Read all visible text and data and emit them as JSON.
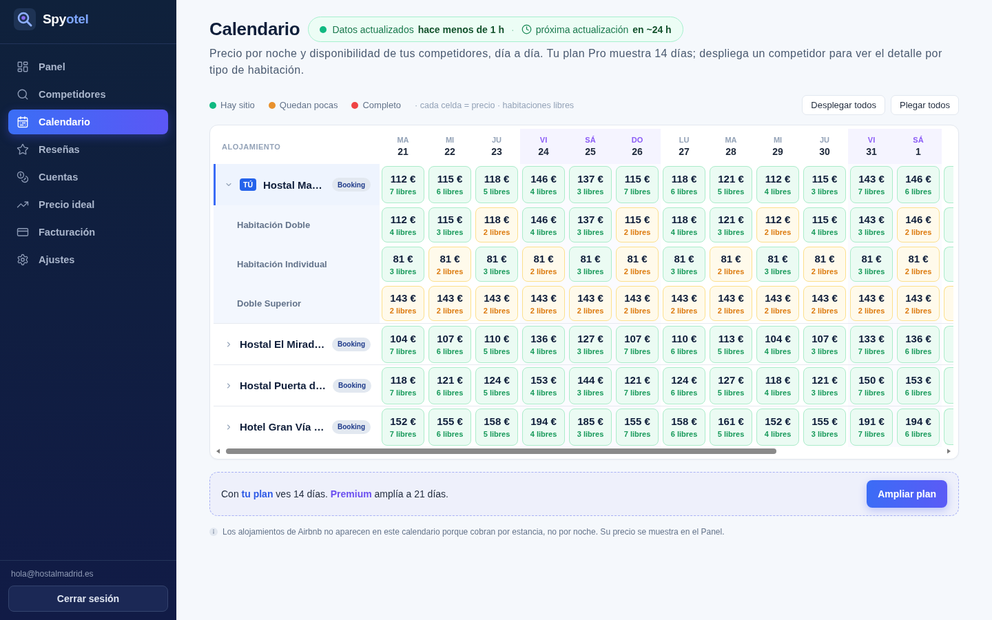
{
  "sidebar": {
    "brand": {
      "lead": "Spy",
      "rest": "otel"
    },
    "nav": [
      {
        "label": "Panel",
        "selected": false
      },
      {
        "label": "Competidores",
        "selected": false
      },
      {
        "label": "Calendario",
        "selected": true
      },
      {
        "label": "Reseñas",
        "selected": false
      },
      {
        "label": "Cuentas",
        "selected": false
      },
      {
        "label": "Precio ideal",
        "selected": false
      },
      {
        "label": "Facturación",
        "selected": false
      },
      {
        "label": "Ajustes",
        "selected": false
      }
    ],
    "email": "hola@hostalmadrid.es",
    "logout": "Cerrar sesión"
  },
  "header": {
    "title": "Calendario",
    "status": {
      "updated_label": "Datos actualizados",
      "updated_value": "hace menos de 1 h",
      "separator": "·",
      "next_label": "próxima actualización",
      "next_value": "en ~24 h"
    },
    "description": "Precio por noche y disponibilidad de tus competidores, día a día. Tu plan Pro muestra 14 días; despliega un competidor para ver el detalle por tipo de habitación."
  },
  "legend": {
    "items": [
      {
        "label": "Hay sitio",
        "color": "#10b981"
      },
      {
        "label": "Quedan pocas",
        "color": "#e8912d"
      },
      {
        "label": "Completo",
        "color": "#ef4444"
      }
    ],
    "note": "· cada celda = precio · habitaciones libres"
  },
  "actions": [
    "Desplegar todos",
    "Plegar todos"
  ],
  "calendar": {
    "column_label": "ALOJAMIENTO",
    "days": [
      {
        "weekday": "MA",
        "date": "21",
        "weekend": false
      },
      {
        "weekday": "MI",
        "date": "22",
        "weekend": false
      },
      {
        "weekday": "JU",
        "date": "23",
        "weekend": false
      },
      {
        "weekday": "VI",
        "date": "24",
        "weekend": true
      },
      {
        "weekday": "SÁ",
        "date": "25",
        "weekend": true
      },
      {
        "weekday": "DO",
        "date": "26",
        "weekend": true
      },
      {
        "weekday": "LU",
        "date": "27",
        "weekend": false
      },
      {
        "weekday": "MA",
        "date": "28",
        "weekend": false
      },
      {
        "weekday": "MI",
        "date": "29",
        "weekend": false
      },
      {
        "weekday": "JU",
        "date": "30",
        "weekend": false
      },
      {
        "weekday": "VI",
        "date": "31",
        "weekend": true
      },
      {
        "weekday": "SÁ",
        "date": "1",
        "weekend": true
      }
    ],
    "properties": [
      {
        "name": "Hostal Ma…",
        "own": true,
        "badge": "TÚ",
        "source": "Booking",
        "expanded": true,
        "cells": [
          {
            "price": "112 €",
            "rooms": "7 libres",
            "kind": "ok"
          },
          {
            "price": "115 €",
            "rooms": "6 libres",
            "kind": "ok"
          },
          {
            "price": "118 €",
            "rooms": "5 libres",
            "kind": "ok"
          },
          {
            "price": "146 €",
            "rooms": "4 libres",
            "kind": "ok"
          },
          {
            "price": "137 €",
            "rooms": "3 libres",
            "kind": "ok"
          },
          {
            "price": "115 €",
            "rooms": "7 libres",
            "kind": "ok"
          },
          {
            "price": "118 €",
            "rooms": "6 libres",
            "kind": "ok"
          },
          {
            "price": "121 €",
            "rooms": "5 libres",
            "kind": "ok"
          },
          {
            "price": "112 €",
            "rooms": "4 libres",
            "kind": "ok"
          },
          {
            "price": "115 €",
            "rooms": "3 libres",
            "kind": "ok"
          },
          {
            "price": "143 €",
            "rooms": "7 libres",
            "kind": "ok"
          },
          {
            "price": "146 €",
            "rooms": "6 libres",
            "kind": "ok"
          },
          {
            "kind": "ok"
          }
        ],
        "rooms": [
          {
            "name": "Habitación Doble",
            "cells": [
              {
                "price": "112 €",
                "rooms": "4 libres",
                "kind": "ok"
              },
              {
                "price": "115 €",
                "rooms": "3 libres",
                "kind": "ok"
              },
              {
                "price": "118 €",
                "rooms": "2 libres",
                "kind": "few"
              },
              {
                "price": "146 €",
                "rooms": "4 libres",
                "kind": "ok"
              },
              {
                "price": "137 €",
                "rooms": "3 libres",
                "kind": "ok"
              },
              {
                "price": "115 €",
                "rooms": "2 libres",
                "kind": "few"
              },
              {
                "price": "118 €",
                "rooms": "4 libres",
                "kind": "ok"
              },
              {
                "price": "121 €",
                "rooms": "3 libres",
                "kind": "ok"
              },
              {
                "price": "112 €",
                "rooms": "2 libres",
                "kind": "few"
              },
              {
                "price": "115 €",
                "rooms": "4 libres",
                "kind": "ok"
              },
              {
                "price": "143 €",
                "rooms": "3 libres",
                "kind": "ok"
              },
              {
                "price": "146 €",
                "rooms": "2 libres",
                "kind": "few"
              },
              {
                "kind": "ok"
              }
            ]
          },
          {
            "name": "Habitación Individual",
            "cells": [
              {
                "price": "81 €",
                "rooms": "3 libres",
                "kind": "ok"
              },
              {
                "price": "81 €",
                "rooms": "2 libres",
                "kind": "few"
              },
              {
                "price": "81 €",
                "rooms": "3 libres",
                "kind": "ok"
              },
              {
                "price": "81 €",
                "rooms": "2 libres",
                "kind": "few"
              },
              {
                "price": "81 €",
                "rooms": "3 libres",
                "kind": "ok"
              },
              {
                "price": "81 €",
                "rooms": "2 libres",
                "kind": "few"
              },
              {
                "price": "81 €",
                "rooms": "3 libres",
                "kind": "ok"
              },
              {
                "price": "81 €",
                "rooms": "2 libres",
                "kind": "few"
              },
              {
                "price": "81 €",
                "rooms": "3 libres",
                "kind": "ok"
              },
              {
                "price": "81 €",
                "rooms": "2 libres",
                "kind": "few"
              },
              {
                "price": "81 €",
                "rooms": "3 libres",
                "kind": "ok"
              },
              {
                "price": "81 €",
                "rooms": "2 libres",
                "kind": "few"
              },
              {
                "kind": "ok"
              }
            ]
          },
          {
            "name": "Doble Superior",
            "cells": [
              {
                "price": "143 €",
                "rooms": "2 libres",
                "kind": "few"
              },
              {
                "price": "143 €",
                "rooms": "2 libres",
                "kind": "few"
              },
              {
                "price": "143 €",
                "rooms": "2 libres",
                "kind": "few"
              },
              {
                "price": "143 €",
                "rooms": "2 libres",
                "kind": "few"
              },
              {
                "price": "143 €",
                "rooms": "2 libres",
                "kind": "few"
              },
              {
                "price": "143 €",
                "rooms": "2 libres",
                "kind": "few"
              },
              {
                "price": "143 €",
                "rooms": "2 libres",
                "kind": "few"
              },
              {
                "price": "143 €",
                "rooms": "2 libres",
                "kind": "few"
              },
              {
                "price": "143 €",
                "rooms": "2 libres",
                "kind": "few"
              },
              {
                "price": "143 €",
                "rooms": "2 libres",
                "kind": "few"
              },
              {
                "price": "143 €",
                "rooms": "2 libres",
                "kind": "few"
              },
              {
                "price": "143 €",
                "rooms": "2 libres",
                "kind": "few"
              },
              {
                "kind": "few"
              }
            ]
          }
        ]
      },
      {
        "name": "Hostal El Mirad…",
        "own": false,
        "source": "Booking",
        "expanded": false,
        "cells": [
          {
            "price": "104 €",
            "rooms": "7 libres",
            "kind": "ok"
          },
          {
            "price": "107 €",
            "rooms": "6 libres",
            "kind": "ok"
          },
          {
            "price": "110 €",
            "rooms": "5 libres",
            "kind": "ok"
          },
          {
            "price": "136 €",
            "rooms": "4 libres",
            "kind": "ok"
          },
          {
            "price": "127 €",
            "rooms": "3 libres",
            "kind": "ok"
          },
          {
            "price": "107 €",
            "rooms": "7 libres",
            "kind": "ok"
          },
          {
            "price": "110 €",
            "rooms": "6 libres",
            "kind": "ok"
          },
          {
            "price": "113 €",
            "rooms": "5 libres",
            "kind": "ok"
          },
          {
            "price": "104 €",
            "rooms": "4 libres",
            "kind": "ok"
          },
          {
            "price": "107 €",
            "rooms": "3 libres",
            "kind": "ok"
          },
          {
            "price": "133 €",
            "rooms": "7 libres",
            "kind": "ok"
          },
          {
            "price": "136 €",
            "rooms": "6 libres",
            "kind": "ok"
          },
          {
            "kind": "ok"
          }
        ]
      },
      {
        "name": "Hostal Puerta d…",
        "own": false,
        "source": "Booking",
        "expanded": false,
        "cells": [
          {
            "price": "118 €",
            "rooms": "7 libres",
            "kind": "ok"
          },
          {
            "price": "121 €",
            "rooms": "6 libres",
            "kind": "ok"
          },
          {
            "price": "124 €",
            "rooms": "5 libres",
            "kind": "ok"
          },
          {
            "price": "153 €",
            "rooms": "4 libres",
            "kind": "ok"
          },
          {
            "price": "144 €",
            "rooms": "3 libres",
            "kind": "ok"
          },
          {
            "price": "121 €",
            "rooms": "7 libres",
            "kind": "ok"
          },
          {
            "price": "124 €",
            "rooms": "6 libres",
            "kind": "ok"
          },
          {
            "price": "127 €",
            "rooms": "5 libres",
            "kind": "ok"
          },
          {
            "price": "118 €",
            "rooms": "4 libres",
            "kind": "ok"
          },
          {
            "price": "121 €",
            "rooms": "3 libres",
            "kind": "ok"
          },
          {
            "price": "150 €",
            "rooms": "7 libres",
            "kind": "ok"
          },
          {
            "price": "153 €",
            "rooms": "6 libres",
            "kind": "ok"
          },
          {
            "kind": "ok"
          }
        ]
      },
      {
        "name": "Hotel Gran Vía …",
        "own": false,
        "source": "Booking",
        "expanded": false,
        "cells": [
          {
            "price": "152 €",
            "rooms": "7 libres",
            "kind": "ok"
          },
          {
            "price": "155 €",
            "rooms": "6 libres",
            "kind": "ok"
          },
          {
            "price": "158 €",
            "rooms": "5 libres",
            "kind": "ok"
          },
          {
            "price": "194 €",
            "rooms": "4 libres",
            "kind": "ok"
          },
          {
            "price": "185 €",
            "rooms": "3 libres",
            "kind": "ok"
          },
          {
            "price": "155 €",
            "rooms": "7 libres",
            "kind": "ok"
          },
          {
            "price": "158 €",
            "rooms": "6 libres",
            "kind": "ok"
          },
          {
            "price": "161 €",
            "rooms": "5 libres",
            "kind": "ok"
          },
          {
            "price": "152 €",
            "rooms": "4 libres",
            "kind": "ok"
          },
          {
            "price": "155 €",
            "rooms": "3 libres",
            "kind": "ok"
          },
          {
            "price": "191 €",
            "rooms": "7 libres",
            "kind": "ok"
          },
          {
            "price": "194 €",
            "rooms": "6 libres",
            "kind": "ok"
          },
          {
            "kind": "ok"
          }
        ]
      }
    ]
  },
  "upsell": {
    "text": "Con **tu plan** ves 14 días. **Premium** amplía a 21 días.",
    "button": "Ampliar plan"
  },
  "note": "Los alojamientos de Airbnb no aparecen en este calendario porque cobran por estancia, no por noche. Su precio se muestra en el Panel."
}
